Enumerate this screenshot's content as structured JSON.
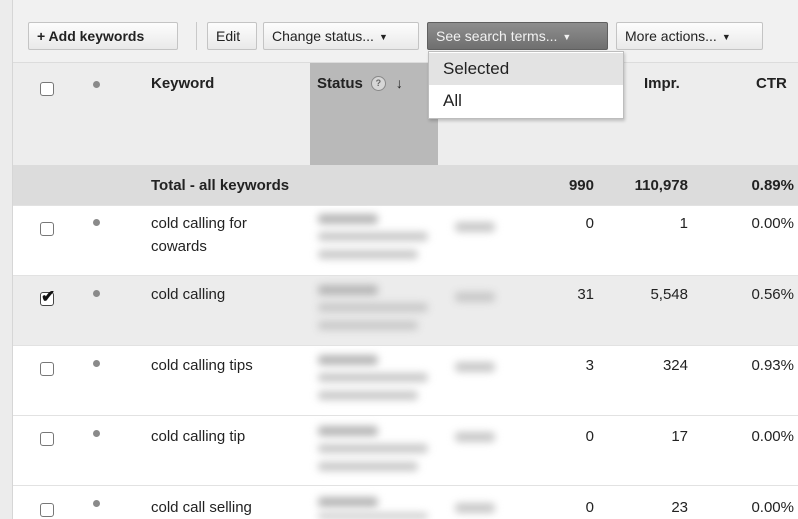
{
  "toolbar": {
    "add_keywords": "+ Add keywords",
    "edit": "Edit",
    "change_status": "Change status...",
    "see_search_terms": "See search terms...",
    "more_actions": "More actions..."
  },
  "dropdown": {
    "items": [
      "Selected",
      "All"
    ]
  },
  "table": {
    "headers": {
      "keyword": "Keyword",
      "status": "Status",
      "status_help": "?",
      "sort_arrow": "↓",
      "impr": "Impr.",
      "ctr": "CTR"
    },
    "total": {
      "label": "Total - all keywords",
      "clicks": "990",
      "impr": "110,978",
      "ctr": "0.89%"
    },
    "rows": [
      {
        "keyword_line1": "cold calling for",
        "keyword_line2": "cowards",
        "clicks": "0",
        "impr": "1",
        "ctr": "0.00%",
        "checked": false
      },
      {
        "keyword_line1": "cold calling",
        "keyword_line2": "",
        "clicks": "31",
        "impr": "5,548",
        "ctr": "0.56%",
        "checked": true
      },
      {
        "keyword_line1": "cold calling tips",
        "keyword_line2": "",
        "clicks": "3",
        "impr": "324",
        "ctr": "0.93%",
        "checked": false
      },
      {
        "keyword_line1": "cold calling tip",
        "keyword_line2": "",
        "clicks": "0",
        "impr": "17",
        "ctr": "0.00%",
        "checked": false
      },
      {
        "keyword_line1": "cold call selling",
        "keyword_line2": "",
        "clicks": "0",
        "impr": "23",
        "ctr": "0.00%",
        "checked": false
      }
    ]
  },
  "icons": {
    "checkmark": "✔",
    "caret": "▼"
  }
}
